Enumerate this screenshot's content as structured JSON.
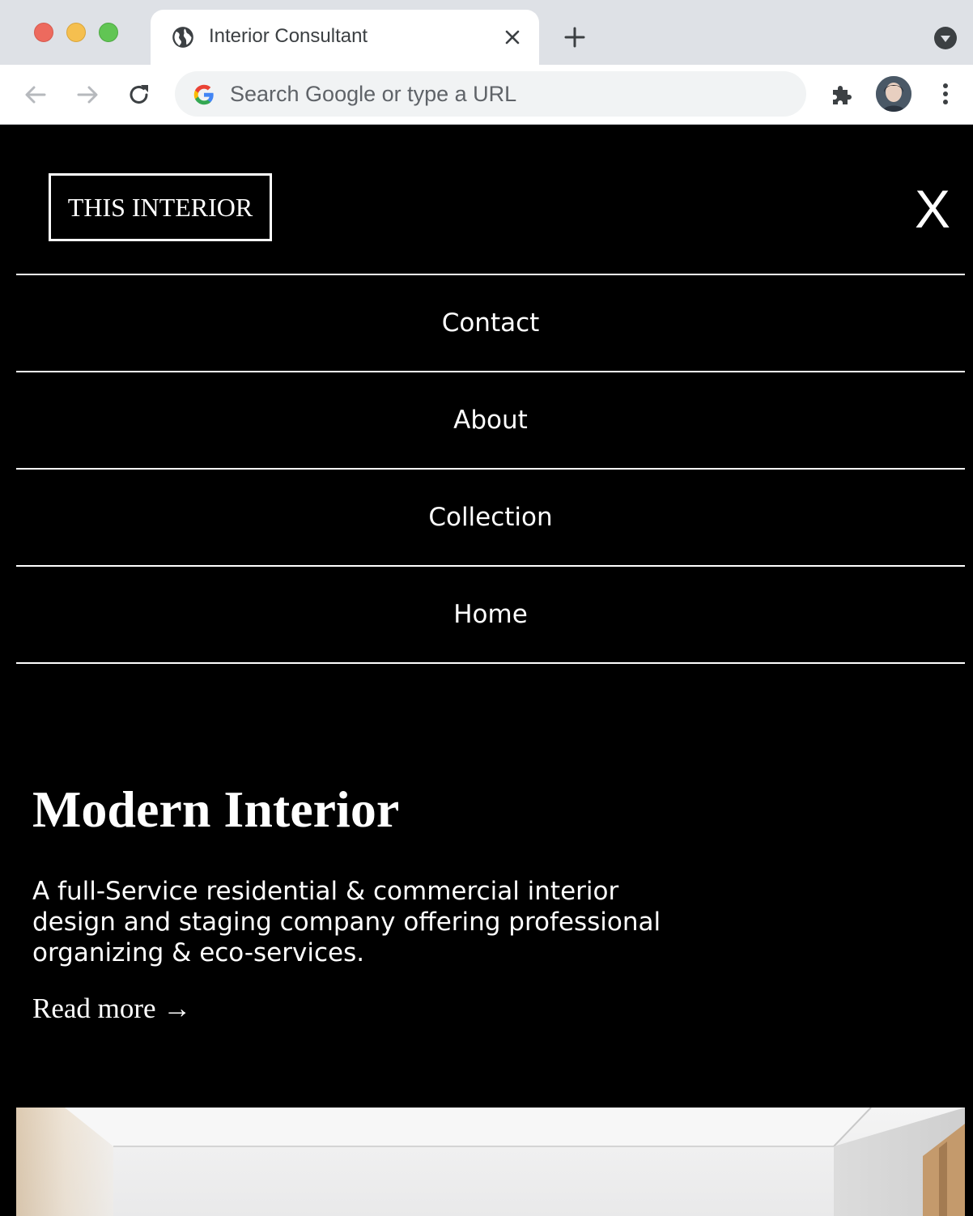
{
  "browser": {
    "tab_title": "Interior Consultant",
    "omnibox_placeholder": "Search Google or type a URL"
  },
  "site": {
    "logo_text": "THIS INTERIOR",
    "close_label": "X",
    "menu": [
      {
        "label": "Contact"
      },
      {
        "label": "About"
      },
      {
        "label": "Collection"
      },
      {
        "label": "Home"
      }
    ],
    "hero": {
      "title": "Modern Interior",
      "description": "A full-Service residential & commercial interior design and staging company offering professional organizing & eco-services.",
      "read_more": "Read more →"
    }
  },
  "colors": {
    "page_background": "#000000",
    "text": "#ffffff",
    "tabbar": "#dee1e6"
  }
}
